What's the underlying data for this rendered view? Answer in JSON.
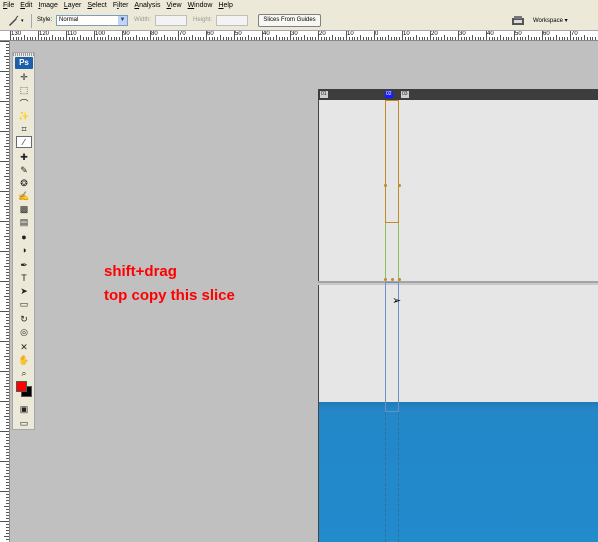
{
  "menu": {
    "items": [
      "File",
      "Edit",
      "Image",
      "Layer",
      "Select",
      "Filter",
      "Analysis",
      "View",
      "Window",
      "Help"
    ]
  },
  "options": {
    "style_label": "Style:",
    "style_value": "Normal",
    "width_label": "Width:",
    "height_label": "Height:",
    "slices_button": "Slices From Guides",
    "workspace_label": "Workspace ▾",
    "icons": [
      "slice-tool-icon",
      "dropdown-arrow-icon",
      "workspace-icon"
    ]
  },
  "ruler": {
    "labels": [
      "130",
      "120",
      "110",
      "100",
      "90",
      "80",
      "70",
      "60",
      "50",
      "40",
      "30",
      "20",
      "10",
      "0",
      "10",
      "20",
      "30",
      "40",
      "50",
      "60",
      "70"
    ]
  },
  "toolbox": {
    "logo": "Ps",
    "tools": [
      {
        "name": "move-icon",
        "glyph": "✛"
      },
      {
        "name": "marquee-icon",
        "glyph": "⬚"
      },
      {
        "name": "lasso-icon",
        "glyph": "⌒"
      },
      {
        "name": "magic-wand-icon",
        "glyph": "✨"
      },
      {
        "name": "crop-icon",
        "glyph": "⌗"
      },
      {
        "name": "slice-icon",
        "glyph": "∕"
      },
      {
        "name": "healing-icon",
        "glyph": "✚"
      },
      {
        "name": "brush-icon",
        "glyph": "✎"
      },
      {
        "name": "stamp-icon",
        "glyph": "❂"
      },
      {
        "name": "history-brush-icon",
        "glyph": "✍"
      },
      {
        "name": "eraser-icon",
        "glyph": "▩"
      },
      {
        "name": "gradient-icon",
        "glyph": "▤"
      },
      {
        "name": "blur-icon",
        "glyph": "●"
      },
      {
        "name": "dodge-icon",
        "glyph": "◑"
      },
      {
        "name": "pen-icon",
        "glyph": "✒"
      },
      {
        "name": "type-icon",
        "glyph": "T"
      },
      {
        "name": "path-select-icon",
        "glyph": "➤"
      },
      {
        "name": "shape-icon",
        "glyph": "▭"
      },
      {
        "name": "3d-rotate-icon",
        "glyph": "↻"
      },
      {
        "name": "3d-orbit-icon",
        "glyph": "◎"
      },
      {
        "name": "eyedropper-icon",
        "glyph": "✕"
      },
      {
        "name": "hand-icon",
        "glyph": "✋"
      },
      {
        "name": "zoom-icon",
        "glyph": "⌕"
      }
    ],
    "foreground_color": "#ff0000",
    "background_color": "#000000"
  },
  "document": {
    "slice_badges": [
      "01",
      "02",
      "03"
    ],
    "light_color": "#e6e6e6",
    "blue_color": "#2387c8"
  },
  "annotation": {
    "line1": "shift+drag",
    "line2": "top copy this slice",
    "color": "#ff0000"
  }
}
